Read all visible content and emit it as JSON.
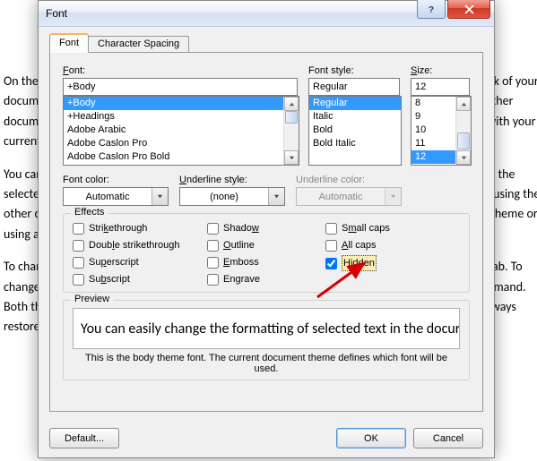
{
  "window": {
    "title": "Font"
  },
  "tabs": {
    "font": "Font",
    "spacing": "Character Spacing"
  },
  "font": {
    "label": "Font:",
    "value": "+Body",
    "list": [
      "+Body",
      "+Headings",
      "Adobe Arabic",
      "Adobe Caslon Pro",
      "Adobe Caslon Pro Bold"
    ]
  },
  "style": {
    "label": "Font style:",
    "value": "Regular",
    "list": [
      "Regular",
      "Italic",
      "Bold",
      "Bold Italic"
    ]
  },
  "size": {
    "label": "Size:",
    "value": "12",
    "list": [
      "8",
      "9",
      "10",
      "11",
      "12"
    ]
  },
  "color": {
    "label": "Font color:",
    "value": "Automatic"
  },
  "ustyle": {
    "label": "Underline style:",
    "value": "(none)"
  },
  "ucolor": {
    "label": "Underline color:",
    "value": "Automatic"
  },
  "effects": {
    "legend": "Effects",
    "strike": "Strikethrough",
    "dstrike": "Double strikethrough",
    "superscript": "Superscript",
    "subscript": "Subscript",
    "shadow": "Shadow",
    "outline": "Outline",
    "emboss": "Emboss",
    "engrave": "Engrave",
    "smallcaps": "Small caps",
    "allcaps": "All caps",
    "hidden": "Hidden"
  },
  "preview": {
    "legend": "Preview",
    "text": "You can easily change the formatting of selected text in the docur",
    "desc": "This is the body theme font. The current document theme defines which font will be used."
  },
  "buttons": {
    "default": "Default...",
    "ok": "OK",
    "cancel": "Cancel"
  },
  "bg": {
    "p1": "On the Insert tab, the galleries include items that are designed to coordinate with the overall look of your document. You can use these galleries to insert tables, headers, footers, lists, cover pages, and other document building blocks. When you create pictures, charts, or diagrams, they also coordinate with your current document look.",
    "p2": "You can easily change the formatting of selected text in the document text by choosing a look for the selected text from the Quick Styles gallery on the Home tab. You can also format text directly by using the other controls on the Home tab. Most controls offer a choice of using the look from the current theme or using a format that you specify directly.",
    "p3": "To change the overall look of your document, choose new Theme elements on the Page Layout tab. To change the looks available in the Quick Style gallery, use the Change Current Quick Style Set command. Both the Themes gallery and the Quick Styles gallery provide reset commands so that you can always restore the look of your document to the original contained in your current template."
  }
}
